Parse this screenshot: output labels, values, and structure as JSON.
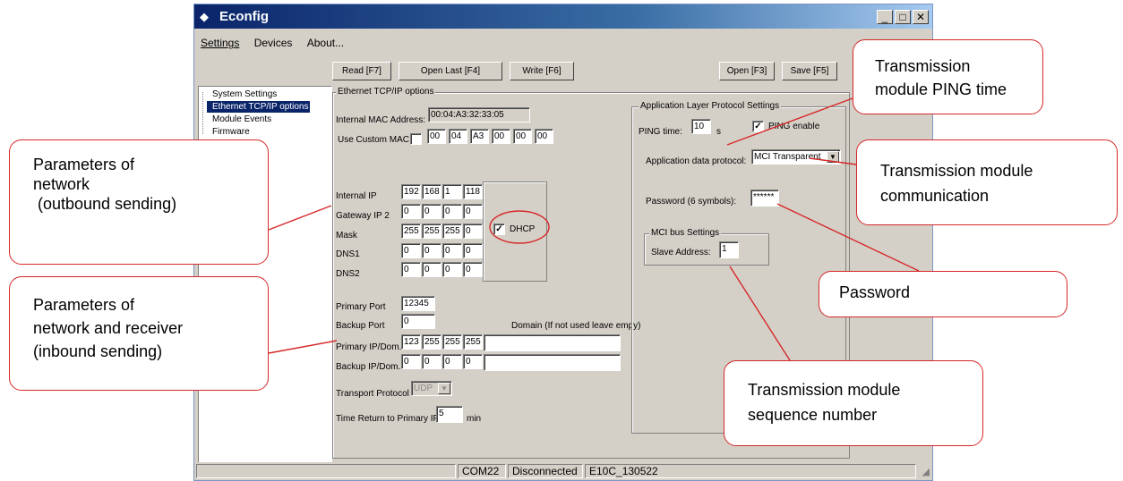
{
  "window": {
    "title": "Econfig",
    "icon": "econfig-app-icon",
    "controls": {
      "minimize": "_",
      "maximize": "□",
      "close": "✕"
    }
  },
  "menu": {
    "items": [
      "Settings",
      "Devices",
      "About..."
    ]
  },
  "toolbar": {
    "read": "Read [F7]",
    "open_last": "Open Last [F4]",
    "write": "Write [F6]",
    "open": "Open [F3]",
    "save": "Save [F5]"
  },
  "tree": {
    "items": [
      "System Settings",
      "Ethernet TCP/IP options",
      "Module Events",
      "Firmware"
    ],
    "selected": "Ethernet TCP/IP options"
  },
  "ethernet": {
    "group_title": "Ethernet TCP/IP options",
    "mac_label": "Internal MAC Address:",
    "mac_value": "00:04:A3:32:33:05",
    "custom_mac_label": "Use Custom MAC",
    "custom_mac_checked": false,
    "custom_mac": [
      "00",
      "04",
      "A3",
      "00",
      "00",
      "00"
    ],
    "internal_ip_label": "Internal  IP",
    "internal_ip": [
      "192",
      "168",
      "1",
      "118"
    ],
    "gateway_label": "Gateway IP 2",
    "gateway": [
      "0",
      "0",
      "0",
      "0"
    ],
    "mask_label": "Mask",
    "mask": [
      "255",
      "255",
      "255",
      "0"
    ],
    "dns1_label": "DNS1",
    "dns1": [
      "0",
      "0",
      "0",
      "0"
    ],
    "dns2_label": "DNS2",
    "dns2": [
      "0",
      "0",
      "0",
      "0"
    ],
    "dhcp_label": "DHCP",
    "dhcp_checked": true,
    "primary_port_label": "Primary Port",
    "primary_port": "12345",
    "backup_port_label": "Backup Port",
    "backup_port": "0",
    "domain_hint": "Domain (If not used leave empy)",
    "primary_ip_label": "Primary IP/Dom.",
    "primary_ip": [
      "123",
      "255",
      "255",
      "255"
    ],
    "primary_domain": "",
    "backup_ip_label": "Backup IP/Dom.",
    "backup_ip": [
      "0",
      "0",
      "0",
      "0"
    ],
    "backup_domain": "",
    "transport_label": "Transport Protocol",
    "transport_value": "UDP",
    "return_label": "Time Return to Primary IP",
    "return_value": "5",
    "return_unit": "min"
  },
  "app_layer": {
    "group_title": "Application Layer Protocol Settings",
    "ping_label": "PING time:",
    "ping_value": "10",
    "ping_unit": "s",
    "ping_enable_label": "PING enable",
    "ping_enable_checked": true,
    "protocol_label": "Application data protocol:",
    "protocol_value": "MCI Transparent",
    "password_label": "Password (6 symbols):",
    "password_value": "******",
    "mci_group_title": "MCI bus Settings",
    "slave_label": "Slave Address:",
    "slave_value": "1"
  },
  "status": {
    "port": "COM22",
    "state": "Disconnected",
    "device": "E10C_130522"
  },
  "callouts": {
    "network_out": [
      "Parameters of",
      "network",
      " (outbound sending)"
    ],
    "network_in": [
      "Parameters of",
      "network and receiver",
      "(inbound sending)"
    ],
    "ping": [
      "Transmission",
      "module PING time"
    ],
    "communication": [
      "Transmission module",
      "communication"
    ],
    "password": [
      "Password"
    ],
    "sequence": [
      "Transmission module",
      "sequence number"
    ]
  },
  "colors": {
    "callout_border": "#d62828",
    "title_bar": "#0a246a",
    "selection": "#0a246a"
  }
}
